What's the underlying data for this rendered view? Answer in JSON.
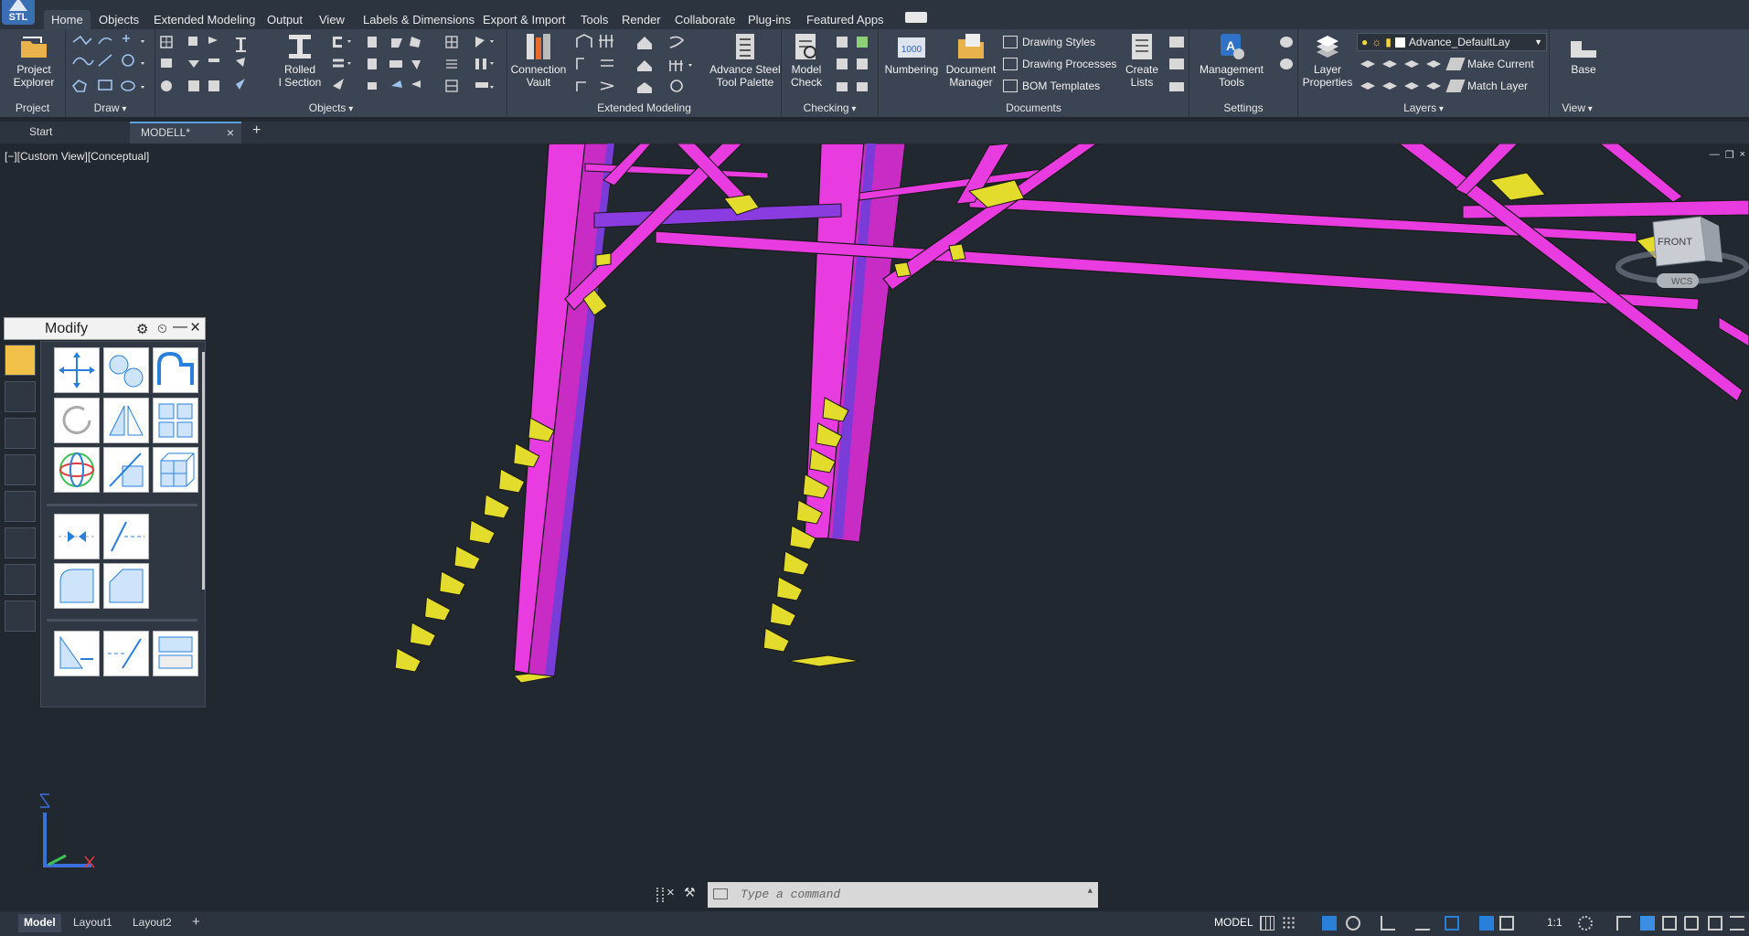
{
  "app": {
    "logo_text": "STL"
  },
  "ribbon_tabs": [
    "Home",
    "Objects",
    "Extended Modeling",
    "Output",
    "View",
    "Labels & Dimensions",
    "Export & Import",
    "Tools",
    "Render",
    "Collaborate",
    "Plug-ins",
    "Featured Apps"
  ],
  "panels": {
    "project": {
      "label": "Project",
      "explorer_line1": "Project",
      "explorer_line2": "Explorer"
    },
    "draw": {
      "label": "Draw"
    },
    "objects": {
      "label": "Objects",
      "rolled_line1": "Rolled",
      "rolled_line2": "I Section"
    },
    "extended": {
      "label": "Extended Modeling",
      "vault_line1": "Connection",
      "vault_line2": "Vault",
      "palette_line1": "Advance Steel",
      "palette_line2": "Tool Palette"
    },
    "checking": {
      "label": "Checking",
      "model_line1": "Model",
      "model_line2": "Check"
    },
    "documents": {
      "label": "Documents",
      "numbering": "Numbering",
      "numbering_badge": "1000",
      "docmgr_line1": "Document",
      "docmgr_line2": "Manager",
      "styles": "Drawing Styles",
      "processes": "Drawing Processes",
      "bom": "BOM Templates",
      "create_line1": "Create",
      "create_line2": "Lists"
    },
    "settings": {
      "label": "Settings",
      "mgmt_line1": "Management",
      "mgmt_line2": "Tools"
    },
    "layers": {
      "label": "Layers",
      "props_line1": "Layer",
      "props_line2": "Properties",
      "current_layer": "Advance_DefaultLay",
      "make_current": "Make Current",
      "match_layer": "Match Layer"
    },
    "view": {
      "label": "View",
      "base": "Base"
    }
  },
  "doc_tabs": {
    "start": "Start",
    "active": "MODELL*"
  },
  "viewport": {
    "label": "[−][Custom View][Conceptual]",
    "viewcube_face": "FRONT",
    "wcs": "WCS"
  },
  "modify_palette": {
    "title": "Modify"
  },
  "command": {
    "placeholder": "Type a command"
  },
  "layout_tabs": [
    "Model",
    "Layout1",
    "Layout2"
  ],
  "status": {
    "model_label": "MODEL",
    "scale": "1:1"
  },
  "colors": {
    "steel": "#e83ce0",
    "plate": "#e4dc2c",
    "background": "#212830",
    "ribbon": "#3b4453"
  }
}
